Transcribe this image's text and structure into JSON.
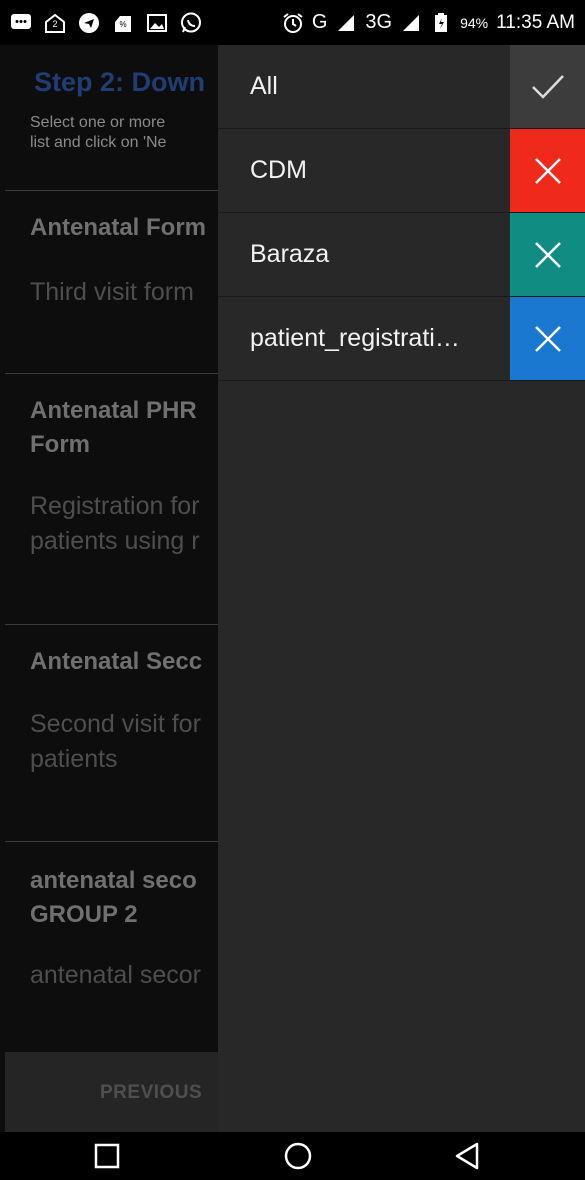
{
  "status_bar": {
    "notification_icons": [
      "message-icon",
      "ucbrowser-icon",
      "telegram-icon",
      "sim-toolkit-icon",
      "gallery-icon",
      "whatsapp-icon"
    ],
    "network": "G",
    "network2": "3G",
    "battery": "94%",
    "time": "11:35 AM"
  },
  "page": {
    "step_title": "Step 2: Down",
    "step_desc_line1": "Select one or more",
    "step_desc_line2": "list and click on 'Ne",
    "forms": [
      {
        "title_line1": "Antenatal Form",
        "title_line2": "",
        "desc_line1": "Third visit form",
        "desc_line2": ""
      },
      {
        "title_line1": "Antenatal PHR",
        "title_line2": "Form",
        "desc_line1": "Registration for",
        "desc_line2": "patients using r"
      },
      {
        "title_line1": "Antenatal Secc",
        "title_line2": "",
        "desc_line1": "Second visit for",
        "desc_line2": "patients"
      },
      {
        "title_line1": "antenatal seco",
        "title_line2": "GROUP 2",
        "desc_line1": "antenatal secor",
        "desc_line2": ""
      }
    ],
    "previous_label": "PREVIOUS"
  },
  "drawer": {
    "filters": [
      {
        "label": "All",
        "state": "check",
        "color": "#3c3c3c"
      },
      {
        "label": "CDM",
        "state": "x",
        "color": "#f02a1a"
      },
      {
        "label": "Baraza",
        "state": "x",
        "color": "#118c82"
      },
      {
        "label": "patient_registrati…",
        "state": "x",
        "color": "#1a78d0"
      }
    ]
  },
  "navbar": {
    "icons": [
      "recents-icon",
      "home-icon",
      "back-icon"
    ]
  }
}
